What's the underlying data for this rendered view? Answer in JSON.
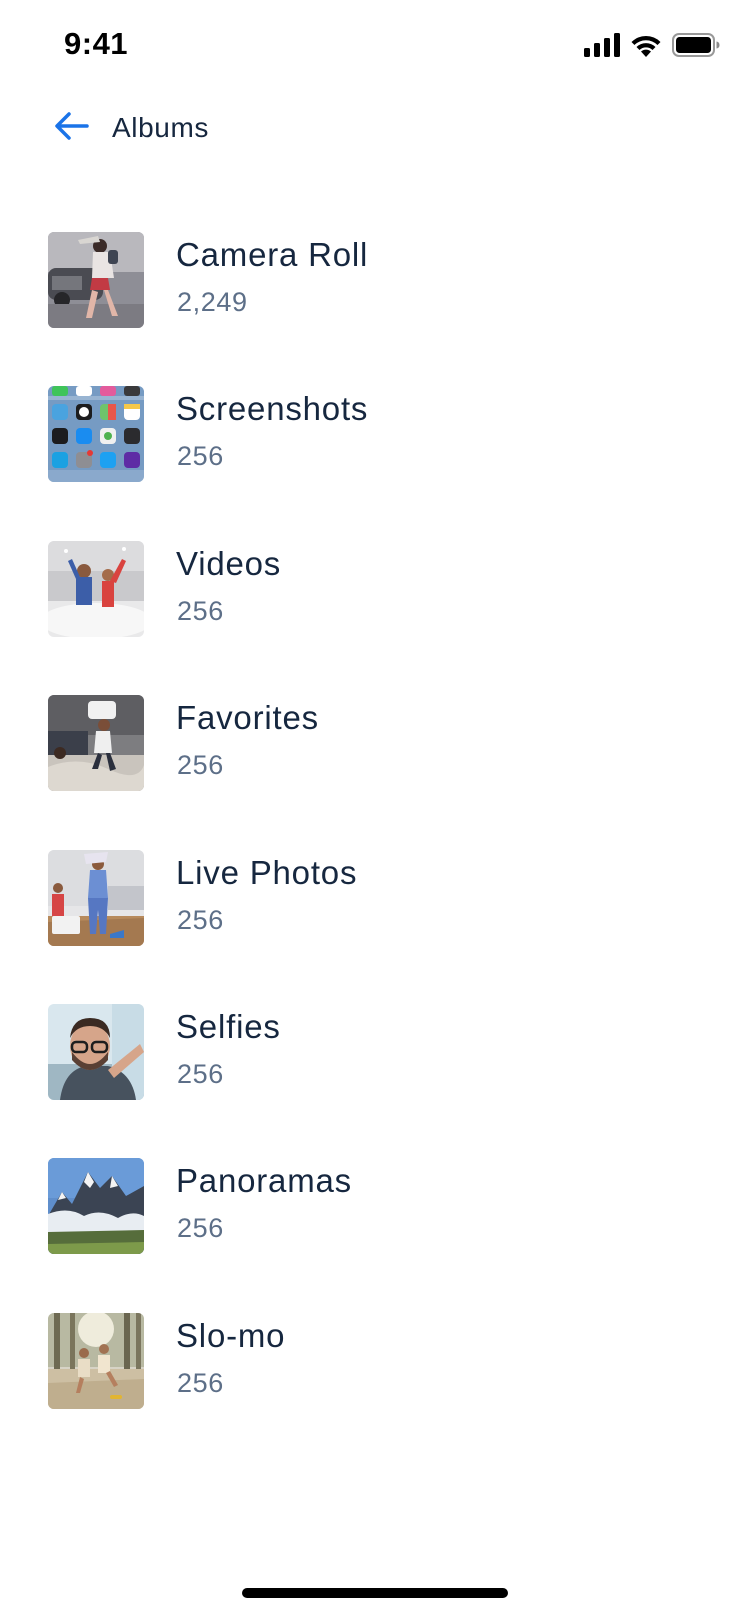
{
  "status_bar": {
    "time": "9:41",
    "icons": [
      "cellular-signal-icon",
      "wifi-icon",
      "battery-icon"
    ]
  },
  "header": {
    "back_icon": "arrow-left-icon",
    "title": "Albums",
    "accent_color": "#1a73e8"
  },
  "albums": [
    {
      "name": "Camera Roll",
      "count": "2,249",
      "thumbnail": "photo-person-running-in-rain"
    },
    {
      "name": "Screenshots",
      "count": "256",
      "thumbnail": "photo-phone-home-screen"
    },
    {
      "name": "Videos",
      "count": "256",
      "thumbnail": "photo-kids-playing-living-room"
    },
    {
      "name": "Favorites",
      "count": "256",
      "thumbnail": "photo-child-pillow-fight-bed"
    },
    {
      "name": "Live Photos",
      "count": "256",
      "thumbnail": "photo-kids-laundry-basket"
    },
    {
      "name": "Selfies",
      "count": "256",
      "thumbnail": "photo-man-selfie-glasses"
    },
    {
      "name": "Panoramas",
      "count": "256",
      "thumbnail": "photo-mountain-peaks"
    },
    {
      "name": "Slo-mo",
      "count": "256",
      "thumbnail": "photo-kids-sprinkler-park"
    }
  ],
  "colors": {
    "title_text": "#16273f",
    "count_text": "#5d6f88",
    "background": "#ffffff"
  }
}
